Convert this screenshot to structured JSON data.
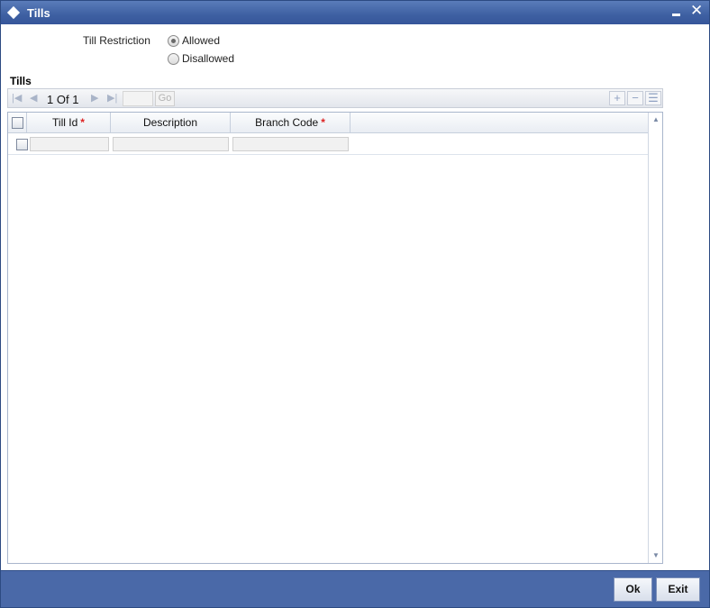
{
  "window": {
    "title": "Tills"
  },
  "restriction": {
    "label": "Till Restriction",
    "options": [
      {
        "label": "Allowed",
        "selected": true
      },
      {
        "label": "Disallowed",
        "selected": false
      }
    ]
  },
  "section": {
    "title": "Tills"
  },
  "pager": {
    "current": "1",
    "of_label": "Of",
    "total": "1",
    "go_label": "Go",
    "page_input": ""
  },
  "grid": {
    "columns": [
      {
        "label": "Till Id",
        "required": true
      },
      {
        "label": "Description",
        "required": false
      },
      {
        "label": "Branch Code",
        "required": true
      }
    ],
    "rows": [
      {
        "till_id": "",
        "description": "",
        "branch_code": ""
      }
    ]
  },
  "footer": {
    "ok_label": "Ok",
    "exit_label": "Exit"
  },
  "colors": {
    "titlebar": "#3e60a2",
    "footer": "#4a69a8",
    "required_marker": "#dd2222"
  },
  "icons": {
    "first": "first-page-icon",
    "prev": "prev-page-icon",
    "next": "next-page-icon",
    "last": "last-page-icon",
    "add": "add-row-icon",
    "delete": "delete-row-icon",
    "view": "view-single-record-icon"
  }
}
